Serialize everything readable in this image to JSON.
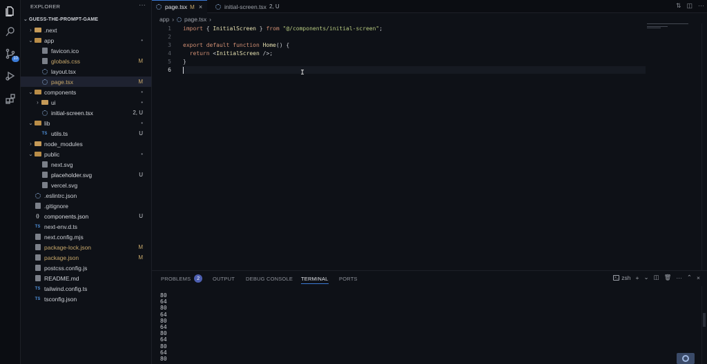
{
  "activity_bar": {
    "icons": [
      "files-icon",
      "search-icon",
      "source-control-icon",
      "run-debug-icon",
      "extensions-icon"
    ],
    "source_control_badge": "10"
  },
  "sidebar": {
    "title": "EXPLORER",
    "root": "GUESS-THE-PROMPT-GAME",
    "items": [
      {
        "label": ".next",
        "indent": 0,
        "type": "folder",
        "expanded": false,
        "status": ""
      },
      {
        "label": "app",
        "indent": 0,
        "type": "folder",
        "expanded": true,
        "status": "•"
      },
      {
        "label": "favicon.ico",
        "indent": 1,
        "type": "file",
        "status": ""
      },
      {
        "label": "globals.css",
        "indent": 1,
        "type": "file",
        "status": "M"
      },
      {
        "label": "layout.tsx",
        "indent": 1,
        "type": "react",
        "status": ""
      },
      {
        "label": "page.tsx",
        "indent": 1,
        "type": "react",
        "status": "M",
        "selected": true
      },
      {
        "label": "components",
        "indent": 0,
        "type": "folder",
        "expanded": true,
        "status": "•"
      },
      {
        "label": "ui",
        "indent": 1,
        "type": "folder",
        "expanded": false,
        "status": "•"
      },
      {
        "label": "initial-screen.tsx",
        "indent": 1,
        "type": "react",
        "status": "2, U"
      },
      {
        "label": "lib",
        "indent": 0,
        "type": "folder",
        "expanded": true,
        "status": "•"
      },
      {
        "label": "utils.ts",
        "indent": 1,
        "type": "ts",
        "status": "U"
      },
      {
        "label": "node_modules",
        "indent": 0,
        "type": "folder",
        "expanded": false,
        "status": ""
      },
      {
        "label": "public",
        "indent": 0,
        "type": "folder",
        "expanded": true,
        "status": "•"
      },
      {
        "label": "next.svg",
        "indent": 1,
        "type": "file",
        "status": ""
      },
      {
        "label": "placeholder.svg",
        "indent": 1,
        "type": "file",
        "status": "U"
      },
      {
        "label": "vercel.svg",
        "indent": 1,
        "type": "file",
        "status": ""
      },
      {
        "label": ".eslintrc.json",
        "indent": 0,
        "type": "gear",
        "status": ""
      },
      {
        "label": ".gitignore",
        "indent": 0,
        "type": "file",
        "status": ""
      },
      {
        "label": "components.json",
        "indent": 0,
        "type": "json",
        "status": "U"
      },
      {
        "label": "next-env.d.ts",
        "indent": 0,
        "type": "ts",
        "status": ""
      },
      {
        "label": "next.config.mjs",
        "indent": 0,
        "type": "file",
        "status": ""
      },
      {
        "label": "package-lock.json",
        "indent": 0,
        "type": "file",
        "status": "M"
      },
      {
        "label": "package.json",
        "indent": 0,
        "type": "file",
        "status": "M"
      },
      {
        "label": "postcss.config.js",
        "indent": 0,
        "type": "file",
        "status": ""
      },
      {
        "label": "README.md",
        "indent": 0,
        "type": "file",
        "status": ""
      },
      {
        "label": "tailwind.config.ts",
        "indent": 0,
        "type": "ts",
        "status": ""
      },
      {
        "label": "tsconfig.json",
        "indent": 0,
        "type": "ts",
        "status": ""
      }
    ]
  },
  "tabs": [
    {
      "label": "page.tsx",
      "mark": "M",
      "active": true,
      "close": "×"
    },
    {
      "label": "initial-screen.tsx",
      "mark": "2, U",
      "active": false
    }
  ],
  "breadcrumb": {
    "folder": "app",
    "sep": "›",
    "file": "page.tsx",
    "more": "›"
  },
  "code": {
    "line_numbers": [
      "1",
      "2",
      "3",
      "4",
      "5",
      "6"
    ],
    "current_line": "6"
  },
  "panel": {
    "tabs": [
      "PROBLEMS",
      "OUTPUT",
      "DEBUG CONSOLE",
      "TERMINAL",
      "PORTS"
    ],
    "problems_count": "2",
    "active_tab": "TERMINAL",
    "shell": "zsh",
    "terminal_lines": [
      "80",
      "64",
      "80",
      "64",
      "80",
      "64",
      "80",
      "64",
      "80",
      "64",
      "80"
    ]
  },
  "colors": {
    "accent": "#3b7bd8",
    "modified": "#c8a86a",
    "untracked": "#7fb07b"
  }
}
